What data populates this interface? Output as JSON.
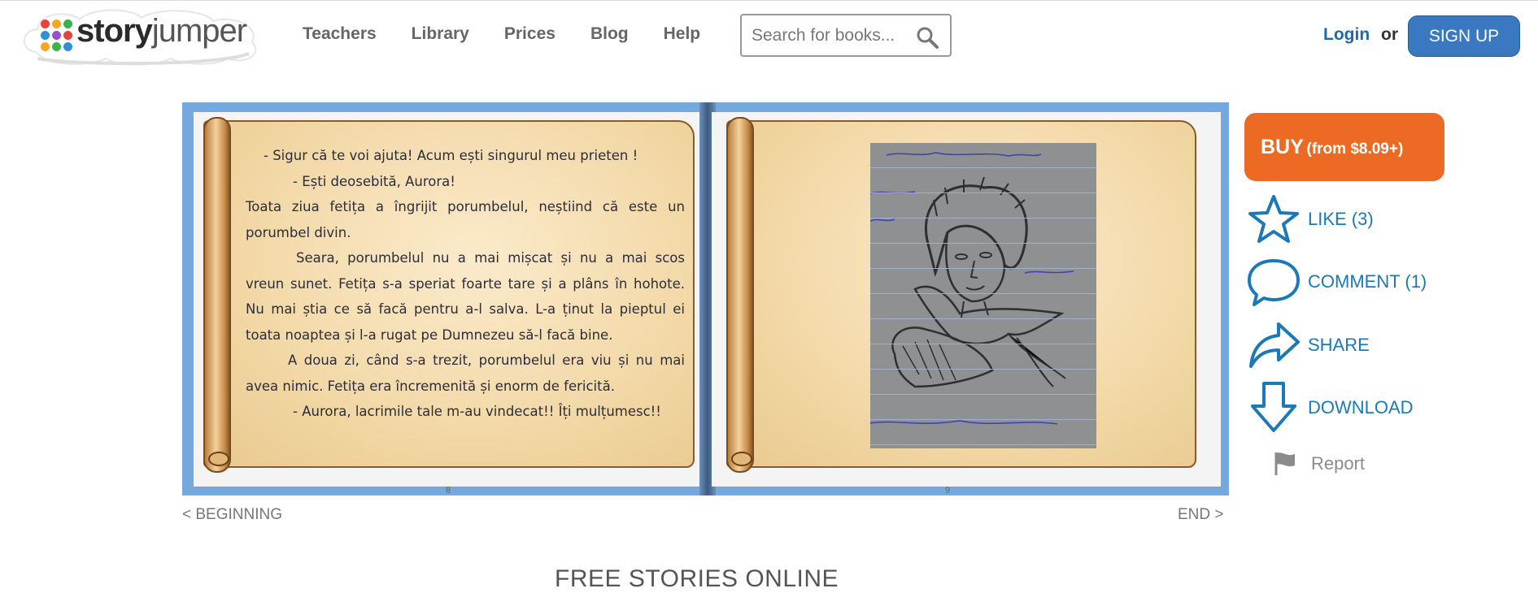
{
  "header": {
    "logo": {
      "text_main": "story",
      "text_accent": "jumper"
    },
    "nav": [
      {
        "label": "Teachers"
      },
      {
        "label": "Library"
      },
      {
        "label": "Prices"
      },
      {
        "label": "Blog"
      },
      {
        "label": "Help"
      }
    ],
    "search": {
      "placeholder": "Search for books...",
      "icon": "search-icon"
    },
    "login_label": "Login",
    "or_label": "or",
    "signup_label": "SIGN UP"
  },
  "book": {
    "left_page": {
      "number": "8",
      "paragraphs": [
        "- Sigur că te voi ajuta! Acum ești singurul meu prieten !",
        "- Ești deosebită, Aurora!",
        "Toata ziua fetița a îngrijit porumbelul, neștiind că este un porumbel divin.",
        "Seara, porumbelul nu a mai mișcat și nu a mai scos vreun sunet. Fetița s-a speriat foarte tare și a plâns în hohote. Nu mai știa ce să facă pentru a-l salva. L-a ținut la pieptul ei toata noaptea și l-a rugat pe Dumnezeu să-l facă bine.",
        "A doua zi, când s-a trezit, porumbelul era viu și nu mai avea nimic. Fetița era încremenită și enorm de fericită.",
        "- Aurora, lacrimile tale m-au vindecat!! Îți mulțumesc!!"
      ]
    },
    "right_page": {
      "number": "9",
      "image": "drawing-girl-holding-dove"
    }
  },
  "actions": {
    "buy": {
      "label": "BUY",
      "price": "(from $8.09+)"
    },
    "like": {
      "label": "LIKE (3)",
      "icon": "star-icon"
    },
    "comment": {
      "label": "COMMENT (1)",
      "icon": "speech-bubble-icon"
    },
    "share": {
      "label": "SHARE",
      "icon": "share-arrow-icon"
    },
    "download": {
      "label": "DOWNLOAD",
      "icon": "download-arrow-icon"
    },
    "report": {
      "label": "Report",
      "icon": "flag-icon"
    }
  },
  "pager": {
    "beginning_label": "< BEGINNING",
    "end_label": "END >"
  },
  "section_title": "FREE STORIES ONLINE",
  "colors": {
    "brand_blue": "#1b79b9",
    "signup_blue": "#3a78c2",
    "buy_orange": "#ec6a24",
    "book_frame": "#76a8e0"
  }
}
